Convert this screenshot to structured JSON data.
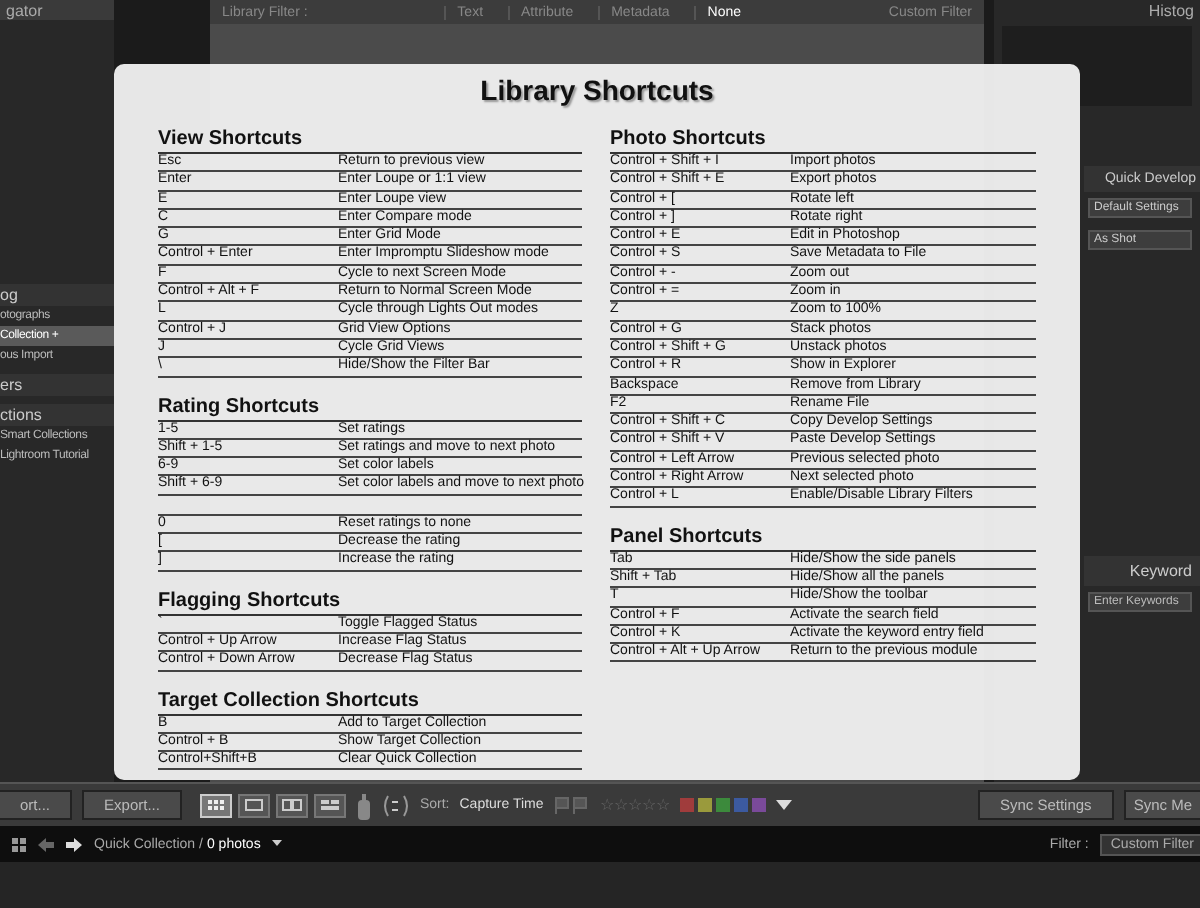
{
  "left_panel": {
    "header": "gator",
    "sections": [
      {
        "title": "og",
        "items": [
          {
            "label": "otographs",
            "selected": false
          },
          {
            "label": "Collection +",
            "selected": true
          },
          {
            "label": "ous Import",
            "selected": false
          }
        ]
      },
      {
        "title": "ers"
      },
      {
        "title": "ctions",
        "items": [
          {
            "label": "Smart Collections",
            "selected": false
          },
          {
            "label": "Lightroom Tutorial",
            "selected": false
          }
        ]
      }
    ]
  },
  "filter_bar": {
    "label": "Library Filter :",
    "tabs": [
      {
        "label": "Text",
        "selected": false
      },
      {
        "label": "Attribute",
        "selected": false
      },
      {
        "label": "Metadata",
        "selected": false
      },
      {
        "label": "None",
        "selected": true
      }
    ],
    "preset": "Custom Filter"
  },
  "right_panel": {
    "header": "Histog",
    "quick_develop": {
      "title": "Quick Develop",
      "preset": "Default Settings",
      "white_balance": "As Shot"
    },
    "keywording": {
      "title": "Keyword",
      "placeholder": "Enter Keywords"
    }
  },
  "dialog": {
    "title": "Library Shortcuts",
    "columns": [
      [
        {
          "title": "View Shortcuts",
          "rows": [
            {
              "key": "Esc",
              "action": "Return to previous view",
              "gap_before": false
            },
            {
              "key": "Enter",
              "action": "Enter Loupe or 1:1 view",
              "gap_before": false
            },
            {
              "key": "E",
              "action": "Enter Loupe view",
              "gap_before": false
            },
            {
              "key": "C",
              "action": "Enter Compare mode",
              "gap_before": false
            },
            {
              "key": "G",
              "action": "Enter Grid Mode",
              "gap_before": false
            },
            {
              "key": "Control + Enter",
              "action": "Enter Impromptu Slideshow mode",
              "gap_before": false
            },
            {
              "key": "F",
              "action": "Cycle to next Screen Mode",
              "gap_before": false
            },
            {
              "key": "Control + Alt + F",
              "action": "Return to Normal Screen Mode",
              "gap_before": false
            },
            {
              "key": "L",
              "action": "Cycle through Lights Out modes",
              "gap_before": false
            },
            {
              "key": "Control + J",
              "action": "Grid View Options",
              "gap_before": false
            },
            {
              "key": "J",
              "action": "Cycle Grid Views",
              "gap_before": false
            },
            {
              "key": "\\",
              "action": "Hide/Show the Filter Bar",
              "gap_before": false
            }
          ]
        },
        {
          "title": "Rating Shortcuts",
          "rows": [
            {
              "key": "1-5",
              "action": "Set ratings",
              "gap_before": false
            },
            {
              "key": "Shift + 1-5",
              "action": "Set ratings and move to next photo",
              "gap_before": false
            },
            {
              "key": "6-9",
              "action": "Set color labels",
              "gap_before": false
            },
            {
              "key": "Shift + 6-9",
              "action": "Set color labels and move to next photo",
              "gap_before": false
            },
            {
              "key": "0",
              "action": "Reset ratings to none",
              "gap_before": true
            },
            {
              "key": "[",
              "action": "Decrease the rating",
              "gap_before": false
            },
            {
              "key": "]",
              "action": "Increase the rating",
              "gap_before": false
            }
          ]
        },
        {
          "title": "Flagging Shortcuts",
          "rows": [
            {
              "key": "`",
              "action": "Toggle Flagged Status",
              "gap_before": false
            },
            {
              "key": "Control + Up Arrow",
              "action": "Increase Flag Status",
              "gap_before": false
            },
            {
              "key": "Control + Down Arrow",
              "action": "Decrease Flag Status",
              "gap_before": false
            }
          ]
        },
        {
          "title": "Target Collection Shortcuts",
          "rows": [
            {
              "key": "B",
              "action": "Add to Target Collection",
              "gap_before": false
            },
            {
              "key": "Control + B",
              "action": "Show Target Collection",
              "gap_before": false
            },
            {
              "key": "Control+Shift+B",
              "action": "Clear Quick Collection",
              "gap_before": false
            }
          ]
        }
      ],
      [
        {
          "title": "Photo Shortcuts",
          "rows": [
            {
              "key": "Control + Shift + I",
              "action": "Import photos",
              "gap_before": false
            },
            {
              "key": "Control + Shift + E",
              "action": "Export photos",
              "gap_before": false
            },
            {
              "key": "Control + [",
              "action": "Rotate left",
              "gap_before": false
            },
            {
              "key": "Control + ]",
              "action": "Rotate right",
              "gap_before": false
            },
            {
              "key": "Control + E",
              "action": "Edit in Photoshop",
              "gap_before": false
            },
            {
              "key": "Control + S",
              "action": "Save Metadata to File",
              "gap_before": false
            },
            {
              "key": "Control + -",
              "action": "Zoom out",
              "gap_before": false
            },
            {
              "key": "Control + =",
              "action": "Zoom in",
              "gap_before": false
            },
            {
              "key": "Z",
              "action": "Zoom to 100%",
              "gap_before": false
            },
            {
              "key": "Control + G",
              "action": "Stack photos",
              "gap_before": false
            },
            {
              "key": "Control + Shift + G",
              "action": "Unstack photos",
              "gap_before": false
            },
            {
              "key": "Control + R",
              "action": "Show in Explorer",
              "gap_before": false
            },
            {
              "key": "Backspace",
              "action": "Remove from Library",
              "gap_before": false
            },
            {
              "key": "F2",
              "action": "Rename File",
              "gap_before": false
            },
            {
              "key": "Control + Shift + C",
              "action": "Copy Develop Settings",
              "gap_before": false
            },
            {
              "key": "Control + Shift + V",
              "action": "Paste Develop Settings",
              "gap_before": false
            },
            {
              "key": "Control + Left Arrow",
              "action": "Previous selected photo",
              "gap_before": false
            },
            {
              "key": "Control + Right Arrow",
              "action": "Next selected photo",
              "gap_before": false
            },
            {
              "key": "Control + L",
              "action": "Enable/Disable Library Filters",
              "gap_before": false
            }
          ]
        },
        {
          "title": "Panel Shortcuts",
          "rows": [
            {
              "key": "Tab",
              "action": "Hide/Show the side panels",
              "gap_before": false
            },
            {
              "key": "Shift + Tab",
              "action": "Hide/Show all the panels",
              "gap_before": false
            },
            {
              "key": "T",
              "action": "Hide/Show the toolbar",
              "gap_before": false
            },
            {
              "key": "Control + F",
              "action": "Activate the search field",
              "gap_before": false
            },
            {
              "key": "Control + K",
              "action": "Activate the keyword entry field",
              "gap_before": false
            },
            {
              "key": "Control + Alt + Up Arrow",
              "action": "Return to the previous module",
              "gap_before": false
            }
          ]
        }
      ]
    ]
  },
  "toolbar": {
    "import_button": "ort...",
    "export_button": "Export...",
    "view_modes": [
      {
        "kind": "grid",
        "selected": true
      },
      {
        "kind": "loupe",
        "selected": false
      },
      {
        "kind": "compare",
        "selected": false
      },
      {
        "kind": "survey",
        "selected": false
      }
    ],
    "sort_label": "Sort:",
    "sort_value": "Capture Time",
    "stars": 0,
    "color_labels": [
      {
        "color": "#a03c3c"
      },
      {
        "color": "#9a9a3c"
      },
      {
        "color": "#3c8a3c"
      },
      {
        "color": "#3c5aa0"
      },
      {
        "color": "#7a4a9a"
      }
    ],
    "sync_settings": "Sync Settings",
    "sync_metadata": "Sync Me"
  },
  "filmstrip_bar": {
    "source": "Quick Collection /",
    "count": "0 photos",
    "filter_label": "Filter :",
    "filter_value": "Custom Filter"
  }
}
